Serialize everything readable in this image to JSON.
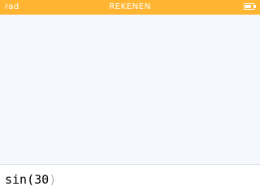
{
  "title_bar": {
    "angle_unit": "rad",
    "app_title": "REKENEN",
    "battery_icon": "battery-icon",
    "battery_level": 0.75
  },
  "history": {
    "entries": []
  },
  "input": {
    "expression": "sin(30",
    "auto_close_paren": ")"
  },
  "colors": {
    "title_bar": "#ffb531",
    "title_text": "#ffffff",
    "history_bg": "#f5f8fd",
    "input_bg": "#ffffff",
    "placeholder_paren": "#b8b8b8"
  }
}
